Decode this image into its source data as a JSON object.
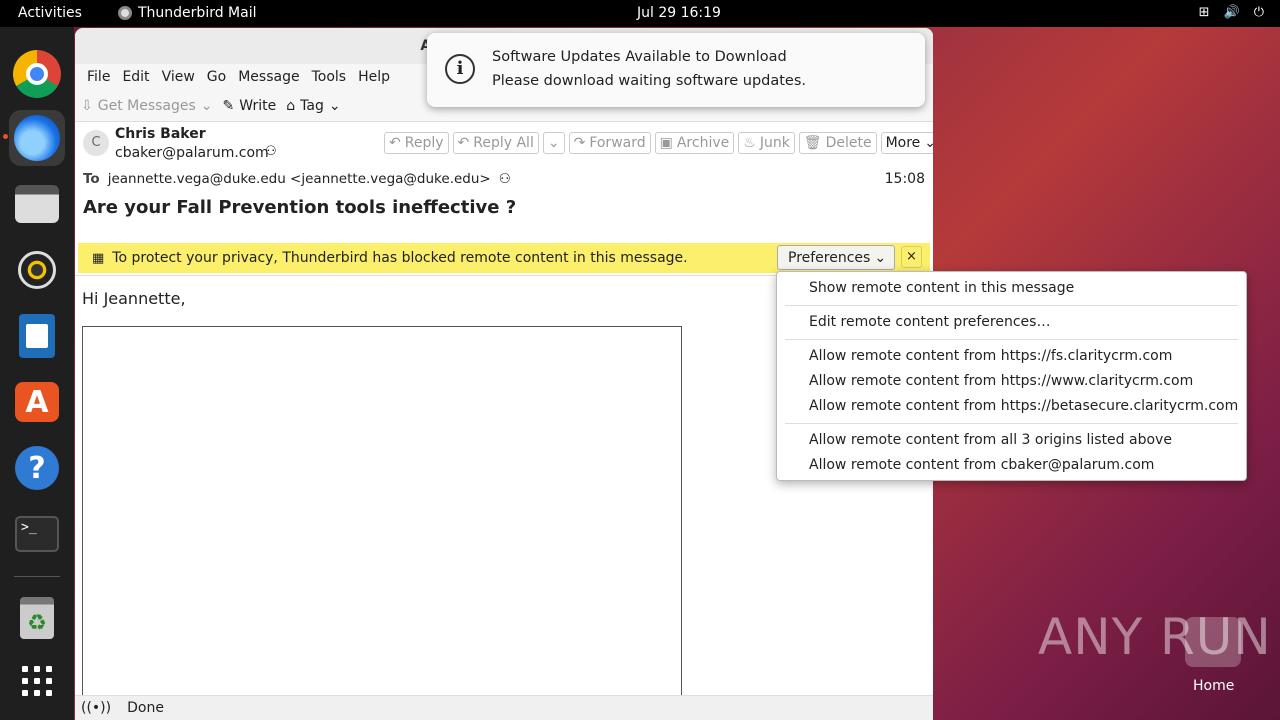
{
  "topbar": {
    "activities": "Activities",
    "app_name": "Thunderbird Mail",
    "clock": "Jul 29  16:19",
    "tray": {
      "network": "network-icon",
      "volume": "volume-icon",
      "power": "power-icon"
    }
  },
  "dock": {
    "items": [
      "chrome-icon",
      "thunderbird-icon",
      "files-icon",
      "rhythmbox-icon",
      "writer-icon",
      "app-center-icon",
      "help-icon",
      "terminal-icon",
      "trash-icon",
      "show-apps-icon"
    ]
  },
  "window": {
    "title": "Are your Fall Prevent",
    "menu": [
      "File",
      "Edit",
      "View",
      "Go",
      "Message",
      "Tools",
      "Help"
    ],
    "toolbar": {
      "get_messages": "Get Messages",
      "write": "Write",
      "tag": "Tag"
    },
    "header": {
      "avatar_letter": "C",
      "sender": "Chris Baker",
      "sender_email": "cbaker@palarum.com",
      "actions": {
        "reply": "Reply",
        "reply_all": "Reply All",
        "forward": "Forward",
        "archive": "Archive",
        "junk": "Junk",
        "delete": "Delete",
        "more": "More"
      },
      "to_label": "To",
      "to_value": "jeannette.vega@duke.edu <jeannette.vega@duke.edu>",
      "time": "15:08",
      "subject": "Are your Fall Prevention tools ineffective ?"
    },
    "notice": {
      "text": "To protect your privacy, Thunderbird has blocked remote content in this message.",
      "preferences": "Preferences",
      "close": "×"
    },
    "body": {
      "greeting": "Hi Jeannette,"
    },
    "status": {
      "text": "Done"
    }
  },
  "toast": {
    "title": "Software Updates Available to Download",
    "message": "Please download waiting software updates."
  },
  "prefs_menu": {
    "items": [
      "Show remote content in this message",
      "Edit remote content preferences…",
      "Allow remote content from https://fs.claritycrm.com",
      "Allow remote content from https://www.claritycrm.com",
      "Allow remote content from https://betasecure.claritycrm.com",
      "Allow remote content from all 3 origins listed above",
      "Allow remote content from cbaker@palarum.com"
    ]
  },
  "desktop": {
    "watermark": "ANY RUN",
    "home_label": "Home"
  }
}
